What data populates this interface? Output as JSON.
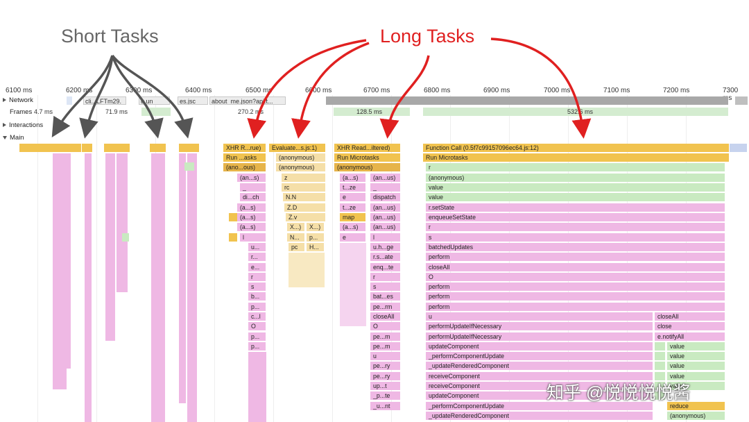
{
  "annotations": {
    "short_tasks": "Short Tasks",
    "long_tasks": "Long Tasks"
  },
  "ruler": [
    "6100 ms",
    "6200 ms",
    "6300 ms",
    "6400 ms",
    "6500 ms",
    "6600 ms",
    "6700 ms",
    "6800 ms",
    "6900 ms",
    "7000 ms",
    "7100 ms",
    "7200 ms",
    "7300 ms"
  ],
  "tracks": {
    "network": "Network",
    "frames": "Frames",
    "interactions": "Interactions",
    "main": "Main"
  },
  "network": [
    "cli...LFTm29.",
    "u un",
    "es.jsc",
    "about_me.json?api.t..."
  ],
  "frames": [
    "4.7 ms",
    "71.9 ms",
    "270.2 ms",
    "128.5 ms",
    "532.6 ms"
  ],
  "task1": {
    "rows": [
      "XHR R...rue)",
      "Run ...asks",
      "(ano...ous)",
      "(an...s)",
      "_",
      "di...ch",
      "(a...s)",
      "(a...s)",
      "(a...s)",
      "l",
      "u...",
      "r...",
      "e...",
      "r",
      "s",
      "b...",
      "p...",
      "c...l",
      "O",
      "p...",
      "p..."
    ]
  },
  "task2": {
    "rows": [
      "Evaluate...s.js:1)",
      "(anonymous)",
      "(anonymous)",
      "z",
      "rc",
      "N.N",
      "Z.D",
      "Z.v",
      "X...)",
      "X...)",
      "N...",
      "p...",
      "pc",
      "H..."
    ]
  },
  "task3": {
    "top": [
      "XHR Read...iltered)",
      "Run Microtasks",
      "(anonymous)"
    ],
    "left": [
      "(a...s)",
      "t...ze",
      "e",
      "t...ze",
      "map",
      "(a...s)",
      "e"
    ],
    "right": [
      "(an...us)",
      "_",
      "dispatch",
      "(an...us)",
      "(an...us)",
      "(an...us)",
      "l",
      "u.h...ge",
      "r.s...ate",
      "enq...te",
      "r",
      "s",
      "bat...es",
      "pe...rm",
      "closeAll",
      "O",
      "pe...m",
      "pe...m",
      "u",
      "pe...ry",
      "pe...ry",
      "up...t",
      "_p...te",
      "_u...nt"
    ]
  },
  "task4": {
    "rows": [
      "Function Call (0.5f7c99157096ec64.js:12)",
      "Run Microtasks",
      "r",
      "(anonymous)",
      "value",
      "value",
      "r.setState",
      "enqueueSetState",
      "r",
      "s",
      "batchedUpdates",
      "perform",
      "closeAll",
      "O",
      "perform",
      "perform",
      "perform",
      "u",
      "performUpdateIfNecessary",
      "performUpdateIfNecessary",
      "updateComponent",
      "_performComponentUpdate",
      "_updateRenderedComponent",
      "receiveComponent",
      "receiveComponent",
      "updateComponent",
      "_performComponentUpdate",
      "_updateRenderedComponent"
    ],
    "side": [
      "closeAll",
      "close",
      "e.notifyAll",
      "value",
      "value",
      "value",
      "value",
      "value",
      "reduce",
      "(anonymous)"
    ]
  },
  "watermark": "知乎 @悦悦悦悦酱",
  "colors": {
    "arrow": "#555555",
    "long_arrow": "#e02020",
    "scripting": "#f1c34f",
    "function": "#efb8e4",
    "frame": "#d4ecd0"
  }
}
